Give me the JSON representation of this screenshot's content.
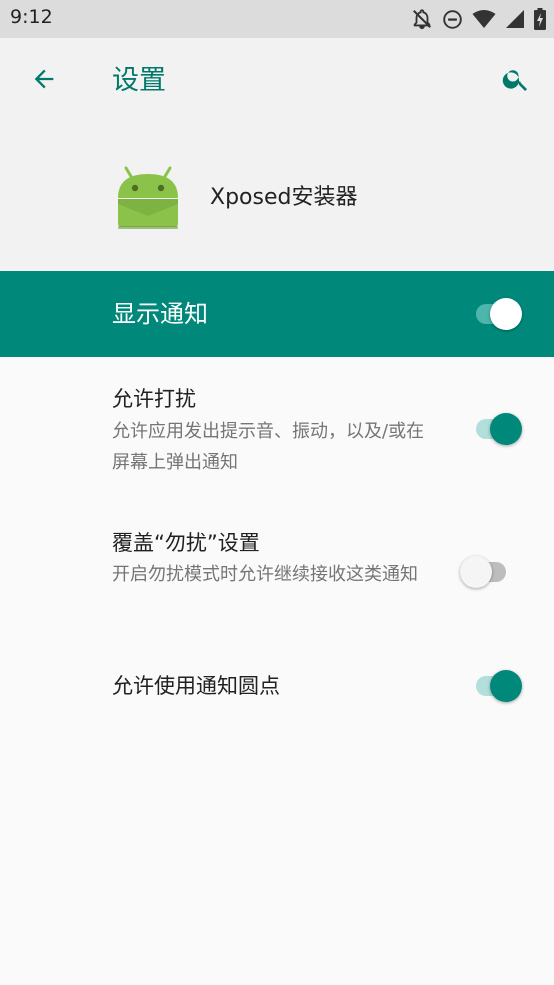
{
  "status_bar": {
    "time": "9:12",
    "icons": [
      "notifications-off-icon",
      "do-not-disturb-icon",
      "wifi-icon",
      "signal-icon",
      "battery-charging-icon"
    ]
  },
  "app_bar": {
    "title": "设置",
    "back_icon": "arrow-back-icon",
    "search_icon": "search-icon"
  },
  "app_header": {
    "app_name": "Xposed安装器",
    "icon": "android-icon"
  },
  "master_toggle": {
    "label": "显示通知",
    "checked": true
  },
  "preferences": [
    {
      "title": "允许打扰",
      "summary": "允许应用发出提示音、振动，以及/或在屏幕上弹出通知",
      "checked": true
    },
    {
      "title": "覆盖“勿扰”设置",
      "summary": "开启勿扰模式时允许继续接收这类通知",
      "checked": false
    },
    {
      "title": "允许使用通知圆点",
      "summary": "",
      "checked": true
    }
  ],
  "colors": {
    "accent": "#00897b",
    "title_text": "#00796b",
    "header_bg": "#f2f2f2",
    "page_bg": "#fafafa"
  }
}
